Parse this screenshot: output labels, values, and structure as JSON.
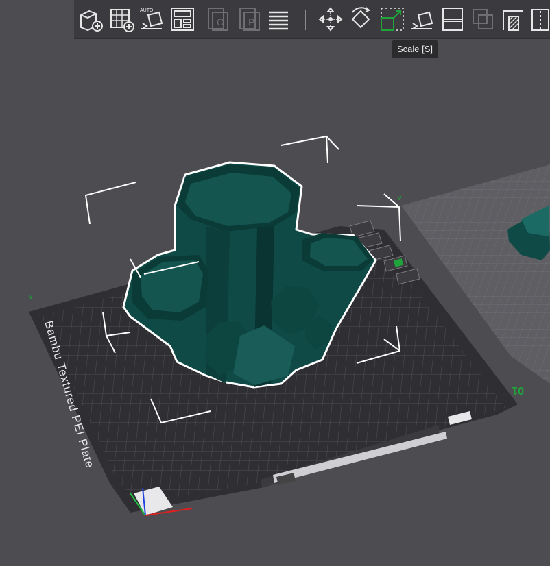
{
  "toolbar": {
    "buttons": [
      {
        "id": "add",
        "icon": "add-object-icon"
      },
      {
        "id": "add-plate",
        "icon": "add-plate-icon"
      },
      {
        "id": "auto-orient",
        "icon": "auto-orient-icon",
        "label": "AUTO"
      },
      {
        "id": "arrange",
        "icon": "arrange-icon"
      },
      {
        "id": "split-objects",
        "icon": "split-objects-icon"
      },
      {
        "id": "split-parts",
        "icon": "split-parts-icon"
      },
      {
        "id": "variable-layer",
        "icon": "layers-icon"
      },
      {
        "id": "move",
        "icon": "move-icon"
      },
      {
        "id": "rotate",
        "icon": "rotate-icon"
      },
      {
        "id": "scale",
        "icon": "scale-icon",
        "active": true
      },
      {
        "id": "lay-on-face",
        "icon": "lay-on-face-icon"
      },
      {
        "id": "cut",
        "icon": "cut-icon"
      },
      {
        "id": "boolean",
        "icon": "boolean-icon"
      },
      {
        "id": "support-paint",
        "icon": "support-paint-icon"
      },
      {
        "id": "seam",
        "icon": "seam-icon"
      }
    ]
  },
  "tooltip": {
    "text": "Scale [S]"
  },
  "plate": {
    "name": "Bambu Textured PEI Plate",
    "number": "01",
    "model_color": "#0f4a46",
    "bed_color": "#2f2f33",
    "grid_color": "#55555a",
    "axis_x_color": "#e02020",
    "axis_y_color": "#20c040",
    "axis_z_color": "#2040e0",
    "accent_green": "#1fa33a"
  }
}
